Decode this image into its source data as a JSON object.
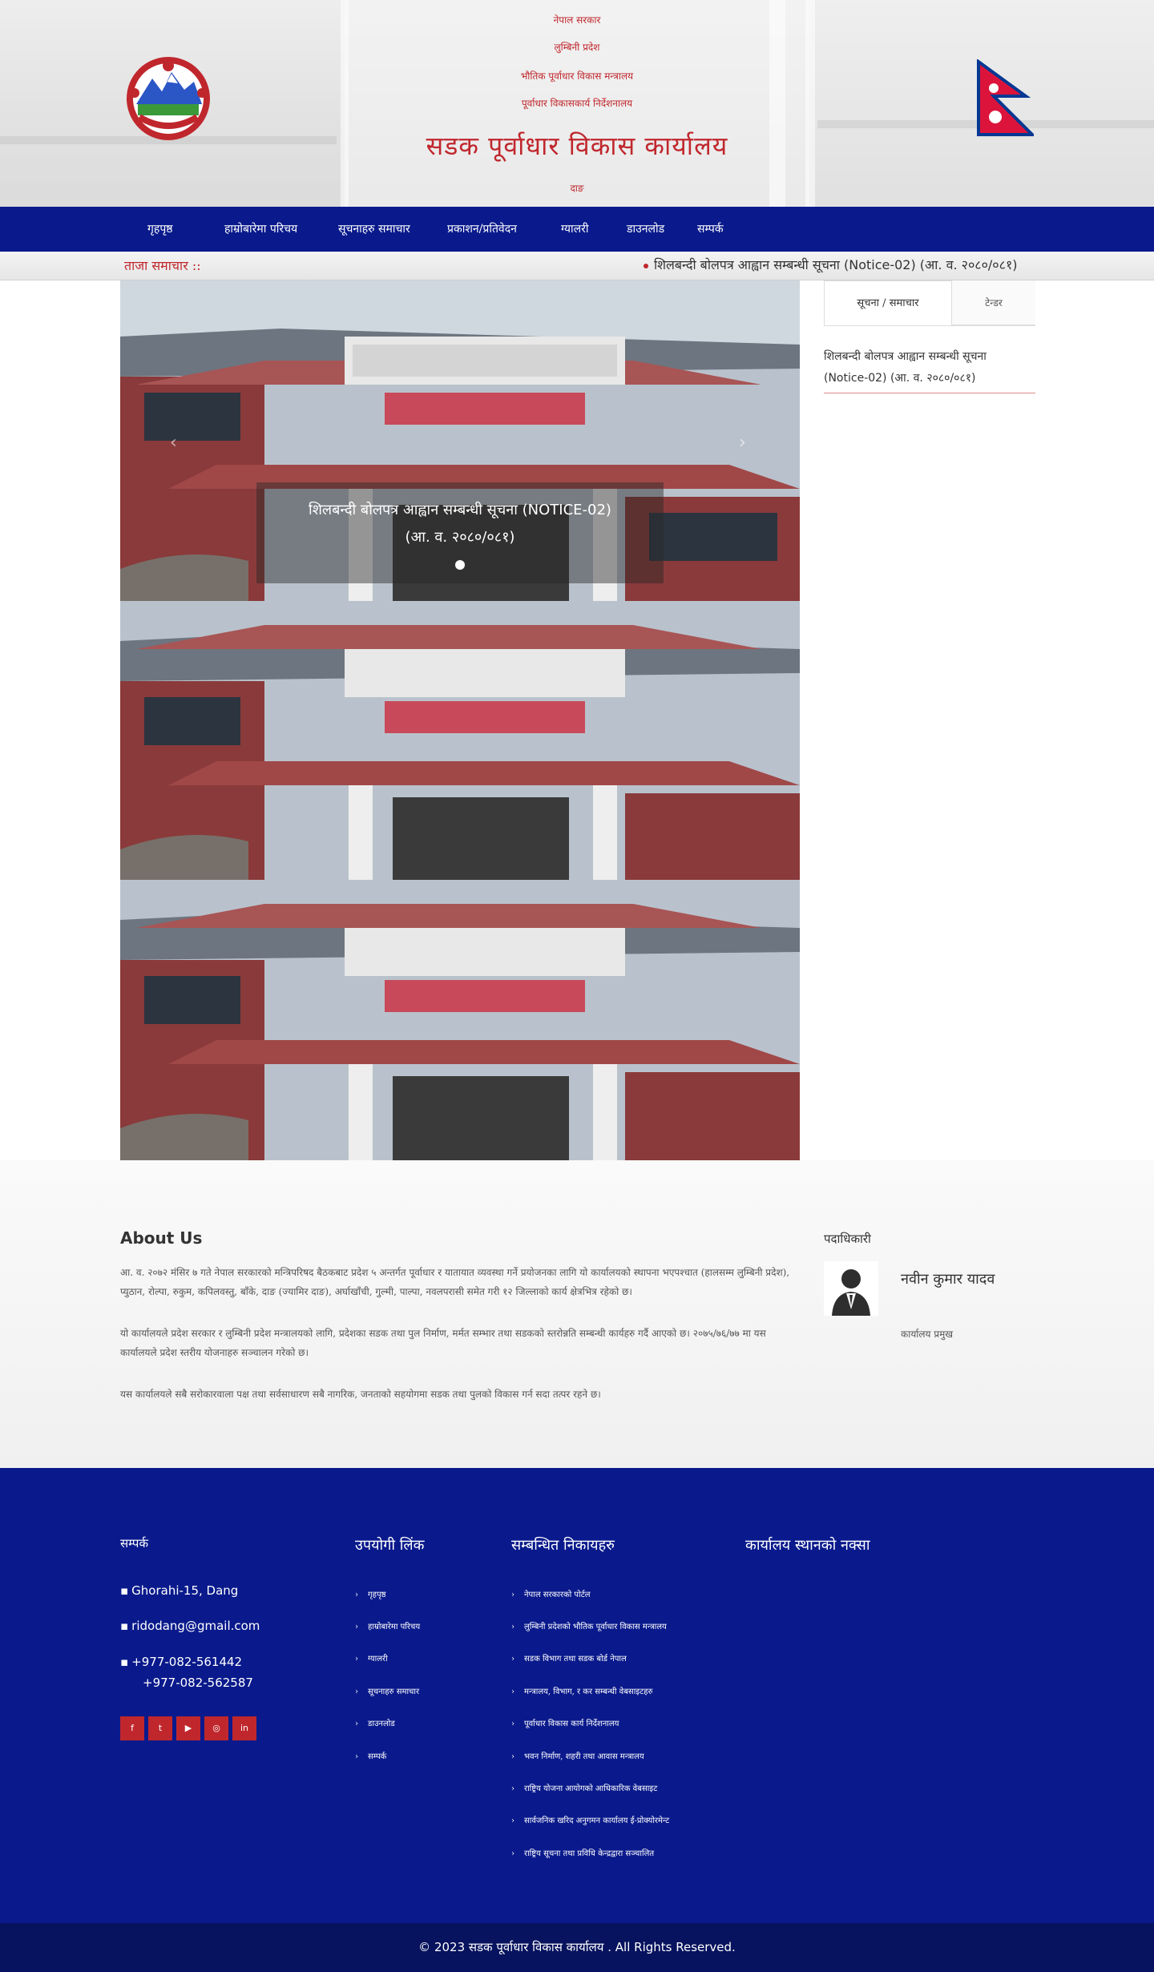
{
  "header": {
    "line1": "नेपाल सरकार",
    "line2": "लुम्बिनी प्रदेश",
    "line3": "भौतिक पूर्वाधार विकास मन्त्रालय",
    "line4": "पूर्वाधार विकासकार्य निर्देशनालय",
    "title": "सडक पूर्वाधार विकास कार्यालय",
    "location": "दाङ"
  },
  "nav": {
    "items": [
      "गृहपृष्ठ",
      "हाम्रोबारेमा परिचय",
      "सूचनाहरु समाचार",
      "प्रकाशन/प्रतिवेदन",
      "ग्यालरी",
      "डाउनलोड",
      "सम्पर्क"
    ]
  },
  "ticker": {
    "label": "ताजा समाचार ::",
    "text": "शिलबन्दी बोलपत्र आह्वान सम्बन्धी सूचना (Notice-02) (आ. व. २०८०/०८१)"
  },
  "slider": {
    "caption_line1": "शिलबन्दी बोलपत्र आह्वान सम्बन्धी सूचना (NOTICE-02)",
    "caption_line2": "(आ. व. २०८०/०८१)",
    "prev_icon": "chevron-left-icon",
    "next_icon": "chevron-right-icon"
  },
  "sidebar": {
    "tab_active": "सूचना / समाचार",
    "tab_inactive": "टेन्डर",
    "notice": "शिलबन्दी बोलपत्र आह्वान सम्बन्धी सूचना (Notice-02) (आ. व. २०८०/०८१)"
  },
  "about": {
    "title": "About Us",
    "p1": "आ. व. २०७२ मंसिर ७ गते नेपाल सरकारको मन्त्रिपरिषद बैठकबाट प्रदेश ५ अन्तर्गत पूर्वाधार र यातायात व्यवस्था गर्ने प्रयोजनका लागि यो कार्यालयको स्थापना भएपश्चात (हालसम्म लुम्बिनी प्रदेश), प्युठान, रोल्पा, रुकुम, कपिलवस्तु, बाँके, दाङ (ज्यामिर दाङ), अर्घाखाँची, गुल्मी, पाल्पा, नवलपरासी समेत गरी १२ जिल्लाको कार्य क्षेत्रभित्र रहेको छ।",
    "p2": "यो कार्यालयले प्रदेश सरकार र लुम्बिनी प्रदेश मन्त्रालयको लागि, प्रदेशका सडक तथा पुल निर्माण, मर्मत सम्भार तथा सडकको स्तरोन्नति सम्बन्धी कार्यहरु गर्दै आएको छ। २०७५/७६/७७ मा यस कार्यालयले प्रदेश स्तरीय योजनाहरु सञ्चालन गरेको छ।",
    "p3": "यस कार्यालयले सबै सरोकारवाला पक्ष तथा सर्वसाधारण सबै नागरिक, जनताको सहयोगमा सडक तथा पुलको विकास गर्न सदा तत्पर रहने छ।"
  },
  "official": {
    "heading": "पदाधिकारी",
    "name": "नवीन कुमार यादव",
    "role": "कार्यालय प्रमुख"
  },
  "footer": {
    "contact_head": "सम्पर्क",
    "address": "Ghorahi-15, Dang",
    "email": "ridodang@gmail.com",
    "phone1": "+977-082-561442",
    "phone2": "+977-082-562587",
    "links_head": "उपयोगी लिंक",
    "links": [
      "गृहपृष्ठ",
      "हाम्रोबारेमा परिचय",
      "ग्यालरी",
      "सूचनाहरु समाचार",
      "डाउनलोड",
      "सम्पर्क"
    ],
    "related_head": "सम्बन्धित निकायहरु",
    "related": [
      "नेपाल सरकारको पोर्टल",
      "लुम्बिनी प्रदेशको भौतिक पूर्वाधार विकास मन्त्रालय",
      "सडक विभाग तथा सडक बोर्ड नेपाल",
      "मन्त्रालय, विभाग, र कर सम्बन्धी वेबसाइटहरु",
      "पूर्वाधार विकास कार्य निर्देशनालय",
      "भवन निर्माण, शहरी तथा आवास मन्त्रालय",
      "राष्ट्रिय योजना आयोगको आधिकारिक वेबसाइट",
      "सार्वजनिक खरिद अनुगमन कार्यालय ई-प्रोक्योरमेन्ट",
      "राष्ट्रिय सूचना तथा प्रविधि केन्द्रद्वारा सञ्चालित"
    ],
    "map_head": "कार्यालय स्थानको नक्सा",
    "social_icons": [
      "facebook-icon",
      "twitter-icon",
      "youtube-icon",
      "instagram-icon",
      "linkedin-icon"
    ],
    "copyright": "© 2023 सडक पूर्वाधार विकास कार्यालय . All Rights Reserved."
  },
  "colors": {
    "primary_navy": "#0a1a8c",
    "accent_red": "#c0272d"
  }
}
